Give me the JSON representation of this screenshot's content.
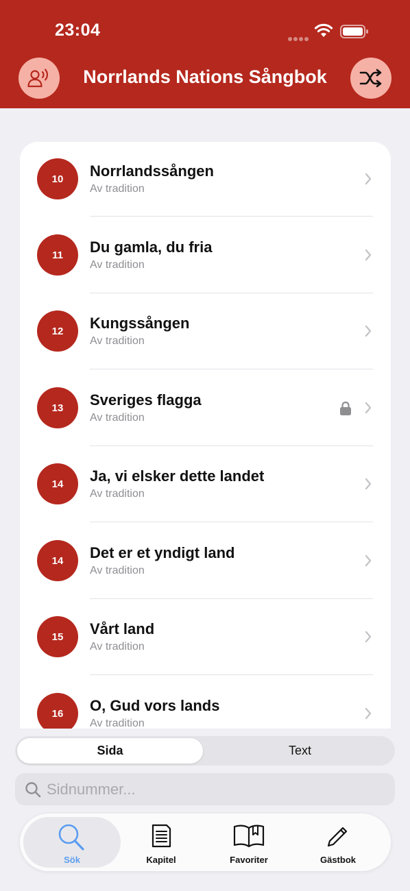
{
  "status_bar": {
    "time": "23:04"
  },
  "header": {
    "title": "Norrlands Nations Sångbok",
    "left_icon": "speaker-listening-icon",
    "right_icon": "shuffle-icon"
  },
  "songs": [
    {
      "number": "10",
      "title": "Norrlandssången",
      "subtitle": "Av tradition",
      "locked": false
    },
    {
      "number": "11",
      "title": "Du gamla, du fria",
      "subtitle": "Av tradition",
      "locked": false
    },
    {
      "number": "12",
      "title": "Kungssången",
      "subtitle": "Av tradition",
      "locked": false
    },
    {
      "number": "13",
      "title": "Sveriges flagga",
      "subtitle": "Av tradition",
      "locked": true
    },
    {
      "number": "14",
      "title": "Ja, vi elsker dette landet",
      "subtitle": "Av tradition",
      "locked": false
    },
    {
      "number": "14",
      "title": "Det er et yndigt land",
      "subtitle": "Av tradition",
      "locked": false
    },
    {
      "number": "15",
      "title": "Vårt land",
      "subtitle": "Av tradition",
      "locked": false
    },
    {
      "number": "16",
      "title": "O, Gud vors lands",
      "subtitle": "Av tradition",
      "locked": false
    }
  ],
  "segmented": {
    "options": [
      "Sida",
      "Text"
    ],
    "selected": "Sida"
  },
  "search": {
    "placeholder": "Sidnummer...",
    "value": ""
  },
  "tabs": [
    {
      "label": "Sök",
      "icon": "search-icon",
      "active": true
    },
    {
      "label": "Kapitel",
      "icon": "document-list-icon",
      "active": false
    },
    {
      "label": "Favoriter",
      "icon": "open-book-bookmark-icon",
      "active": false
    },
    {
      "label": "Gästbok",
      "icon": "pencil-icon",
      "active": false
    }
  ],
  "colors": {
    "brand": "#b5281e",
    "header_button": "#f6b1a6",
    "active_tab": "#5b9cf0"
  }
}
